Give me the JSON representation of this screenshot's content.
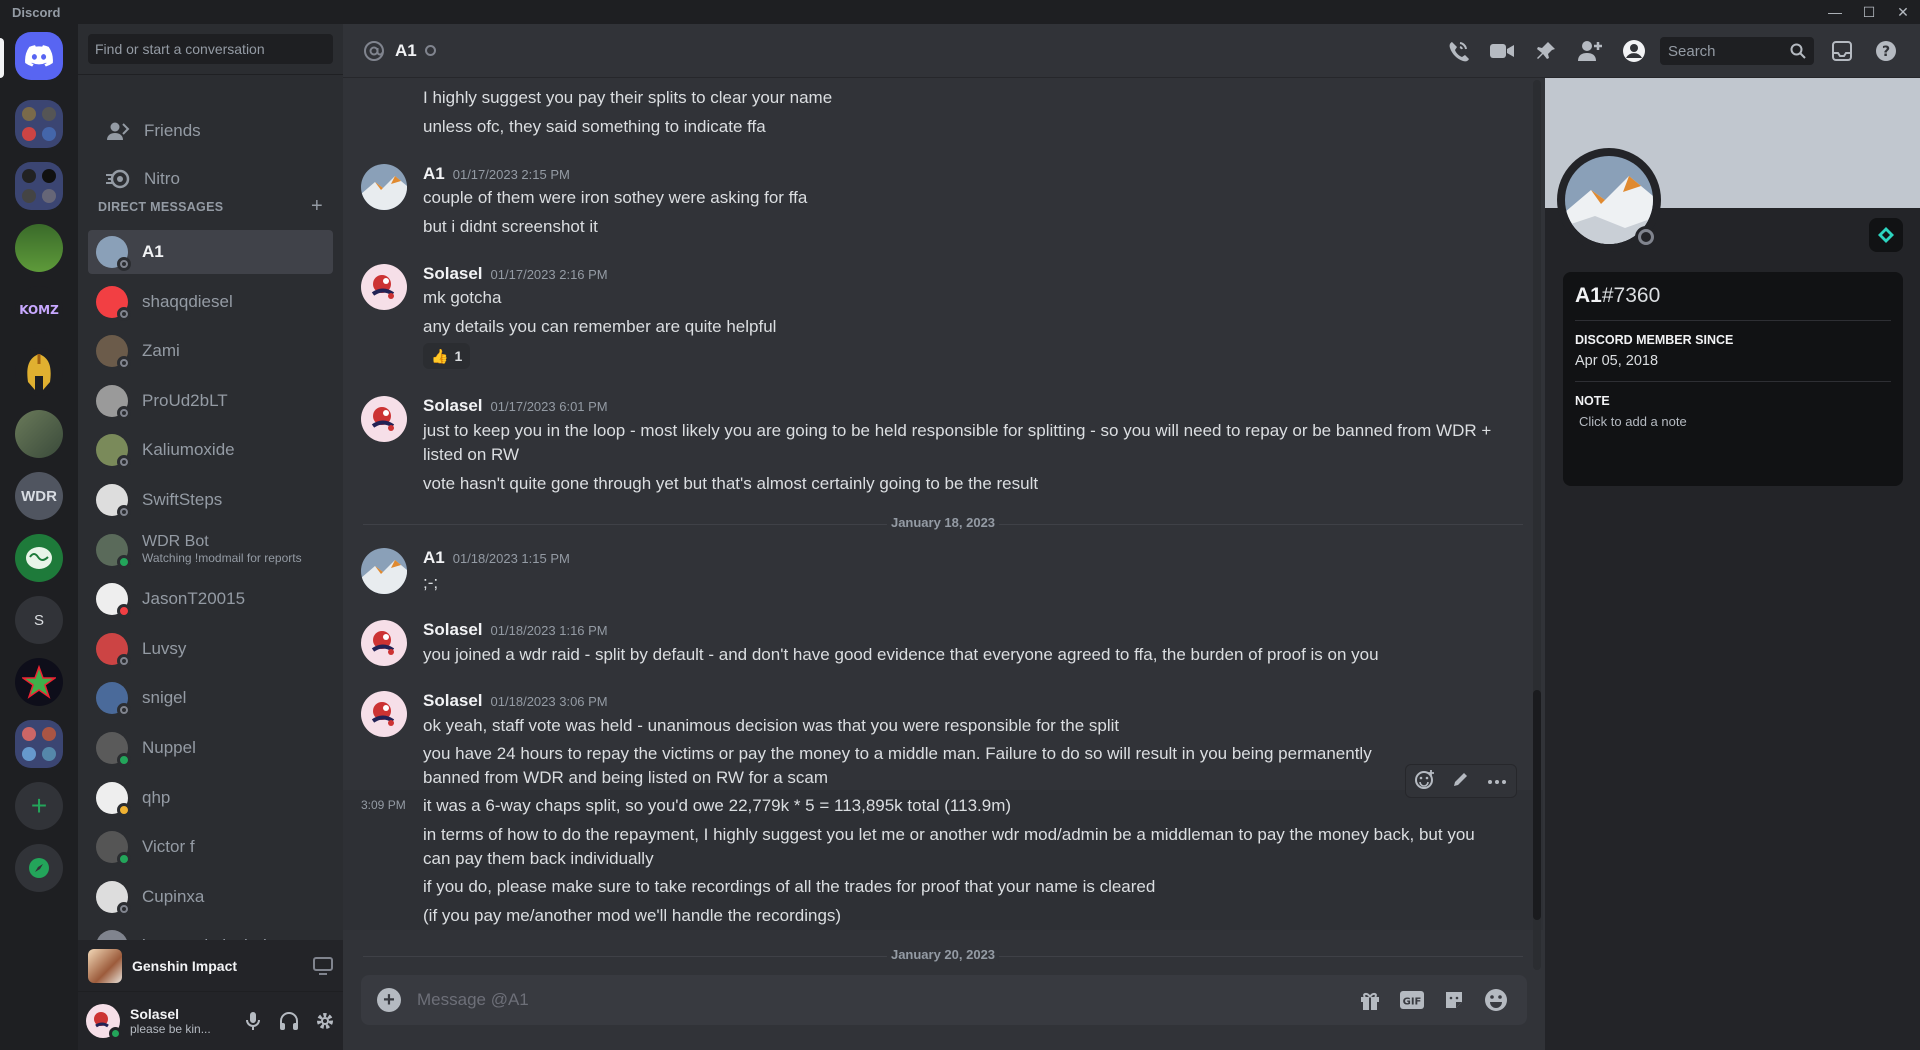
{
  "window": {
    "title": "Discord"
  },
  "dm_sidebar": {
    "search_placeholder": "Find or start a conversation",
    "nav": [
      {
        "label": "Friends"
      },
      {
        "label": "Nitro"
      }
    ],
    "section_title": "DIRECT MESSAGES",
    "dms": [
      {
        "name": "A1",
        "sub": "",
        "status": "offline"
      },
      {
        "name": "shaqqdiesel",
        "sub": "",
        "status": "offline"
      },
      {
        "name": "Zami",
        "sub": "",
        "status": "offline"
      },
      {
        "name": "ProUd2bLT",
        "sub": "",
        "status": "offline"
      },
      {
        "name": "Kaliumoxide",
        "sub": "",
        "status": "offline"
      },
      {
        "name": "SwiftSteps",
        "sub": "",
        "status": "offline"
      },
      {
        "name": "WDR Bot",
        "sub": "Watching !modmail for reports",
        "status": "online"
      },
      {
        "name": "JasonT20015",
        "sub": "",
        "status": "dnd"
      },
      {
        "name": "Luvsy",
        "sub": "",
        "status": "offline"
      },
      {
        "name": "snigel",
        "sub": "",
        "status": "offline"
      },
      {
        "name": "Nuppel",
        "sub": "",
        "status": "online"
      },
      {
        "name": "qhp",
        "sub": "",
        "status": "idle"
      },
      {
        "name": "Victor f",
        "sub": "",
        "status": "online"
      },
      {
        "name": "Cupinxa",
        "sub": "",
        "status": "offline"
      },
      {
        "name": "joaonorrisdasbabes",
        "sub": "",
        "status": "offline"
      }
    ],
    "activity": {
      "game": "Genshin Impact"
    },
    "user": {
      "name": "Solasel",
      "status_text": "please be kin..."
    }
  },
  "guilds": [
    {
      "type": "home"
    },
    {
      "type": "folder"
    },
    {
      "type": "folder"
    },
    {
      "type": "server"
    },
    {
      "label": "KOMZ"
    },
    {
      "type": "server"
    },
    {
      "type": "server"
    },
    {
      "label": "WDR"
    },
    {
      "type": "server"
    },
    {
      "label": "S"
    },
    {
      "type": "server"
    },
    {
      "type": "folder"
    },
    {
      "type": "add"
    },
    {
      "type": "explore"
    }
  ],
  "chat": {
    "channel_name": "A1",
    "search_placeholder": "Search",
    "composer_placeholder": "Message @A1",
    "lines_top": [
      "I highly suggest you pay their splits to clear your name",
      "unless ofc, they said something to indicate ffa"
    ],
    "messages": [
      {
        "author": "A1",
        "time": "01/17/2023 2:15 PM",
        "lines": [
          "couple of them were iron sothey were asking for ffa",
          "but i didnt screenshot it"
        ]
      },
      {
        "author": "Solasel",
        "time": "01/17/2023 2:16 PM",
        "lines": [
          "mk gotcha",
          "any details you can remember are quite helpful"
        ],
        "reaction": {
          "emoji": "👍",
          "count": "1"
        }
      },
      {
        "author": "Solasel",
        "time": "01/17/2023 6:01 PM",
        "lines": [
          "just to keep you in the loop - most likely you are going to be held responsible for splitting - so you will need to repay or be banned from WDR + listed on RW",
          "vote hasn't quite gone through yet but that's almost certainly going to be the result"
        ]
      },
      {
        "author": "A1",
        "time": "01/18/2023 1:15 PM",
        "lines": [
          ";-;"
        ]
      },
      {
        "author": "Solasel",
        "time": "01/18/2023 1:16 PM",
        "lines": [
          "you joined a wdr raid - split by default - and don't have good evidence that everyone agreed to ffa, the burden of proof is on you"
        ]
      },
      {
        "author": "Solasel",
        "time": "01/18/2023 3:06 PM",
        "lines": [
          "ok yeah, staff vote was held - unanimous decision was that you were responsible for the split",
          "you have 24 hours to repay the victims or pay the money to a middle man. Failure to do so will result in you being permanently banned from WDR and being listed on RW for a scam"
        ]
      }
    ],
    "continued": {
      "time": "3:09 PM",
      "lines": [
        "it was a 6-way chaps split, so you'd owe 22,779k * 5  = 113,895k total (113.9m)",
        "in terms of how to do the repayment, I highly suggest you let me or another wdr mod/admin be a middleman to pay the money back, but you can pay them back individually",
        "if you do, please make sure to take recordings of all the trades for proof that your name is cleared",
        "(if you pay me/another mod we'll handle the recordings)"
      ]
    },
    "dates": [
      "January 18, 2023",
      "January 20, 2023"
    ]
  },
  "profile": {
    "username": "A1",
    "discriminator": "#7360",
    "member_since_label": "DISCORD MEMBER SINCE",
    "member_since": "Apr 05, 2018",
    "note_label": "NOTE",
    "note_placeholder": "Click to add a note"
  },
  "colors": {
    "accent": "#5865f2",
    "online": "#23a55a",
    "dnd": "#f23f43",
    "idle": "#f0b232",
    "offline": "#80848e"
  }
}
